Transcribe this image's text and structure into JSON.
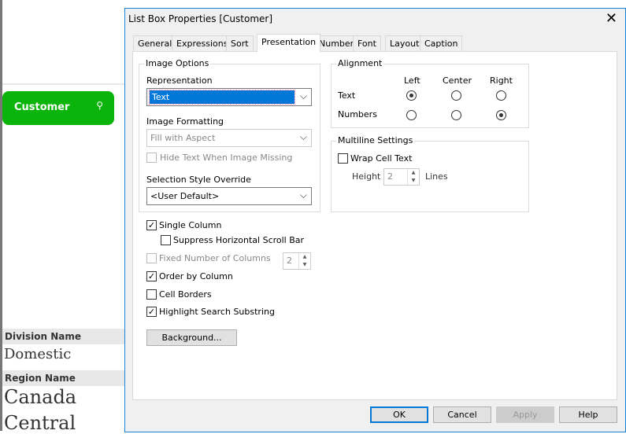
{
  "background": {
    "customer_button": "Customer",
    "division": {
      "header": "Division Name",
      "values": [
        "Domestic"
      ]
    },
    "region": {
      "header": "Region Name",
      "values": [
        "Canada",
        "Central"
      ]
    }
  },
  "dialog": {
    "title": "List Box Properties [Customer]",
    "tabs": [
      "General",
      "Expressions",
      "Sort",
      "Presentation",
      "Number",
      "Font",
      "Layout",
      "Caption"
    ],
    "active_tab": "Presentation",
    "image_options": {
      "legend": "Image Options",
      "representation_label": "Representation",
      "representation_value": "Text",
      "image_formatting_label": "Image Formatting",
      "image_formatting_value": "Fill with Aspect",
      "hide_text_label": "Hide Text When Image Missing",
      "selection_style_label": "Selection Style Override",
      "selection_style_value": "<User Default>"
    },
    "options": {
      "single_column": "Single Column",
      "suppress_hscroll": "Suppress Horizontal Scroll Bar",
      "fixed_columns": "Fixed Number of Columns",
      "fixed_columns_value": "2",
      "order_by_column": "Order by Column",
      "cell_borders": "Cell Borders",
      "highlight_search": "Highlight Search Substring",
      "background_button": "Background..."
    },
    "alignment": {
      "legend": "Alignment",
      "cols": [
        "Left",
        "Center",
        "Right"
      ],
      "rows": [
        "Text",
        "Numbers"
      ],
      "text": "Left",
      "numbers": "Right"
    },
    "multiline": {
      "legend": "Multiline Settings",
      "wrap": "Wrap Cell Text",
      "height_label": "Height",
      "height_value": "2",
      "lines": "Lines"
    },
    "buttons": {
      "ok": "OK",
      "cancel": "Cancel",
      "apply": "Apply",
      "help": "Help"
    }
  }
}
